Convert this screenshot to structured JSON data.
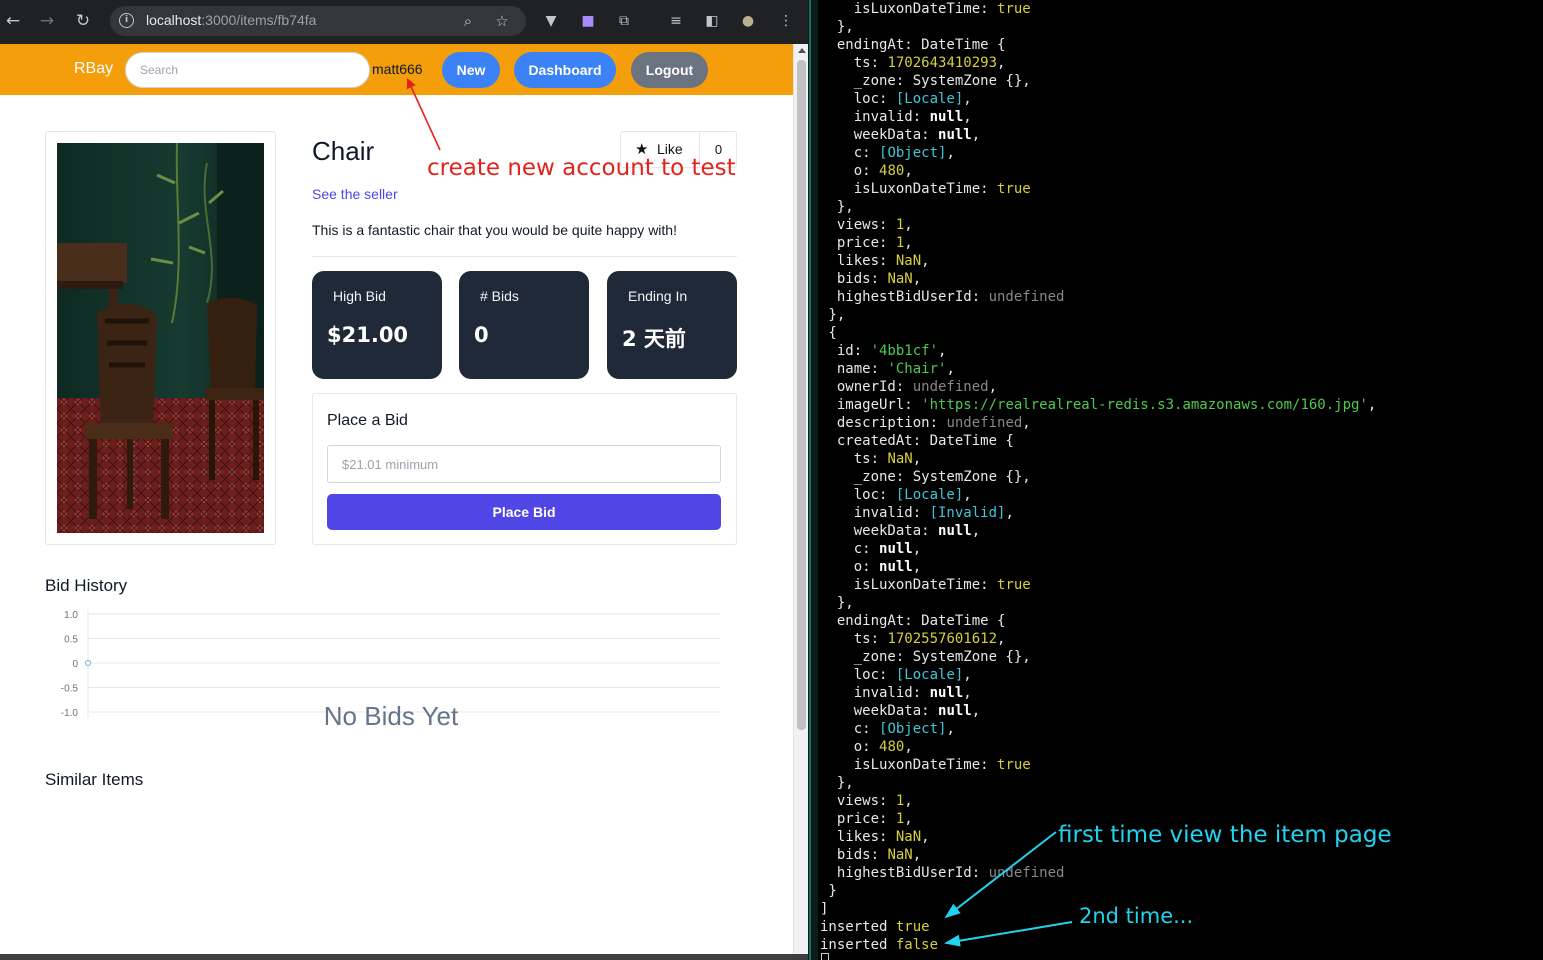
{
  "browser": {
    "url_host": "localhost",
    "url_path": ":3000/items/fb74fa"
  },
  "navbar": {
    "brand": "RBay",
    "search_placeholder": "Search",
    "username": "matt666",
    "new_label": "New",
    "dashboard_label": "Dashboard",
    "logout_label": "Logout"
  },
  "item": {
    "title": "Chair",
    "like_label": "Like",
    "like_count": "0",
    "seller_link": "See the seller",
    "description": "This is a fantastic chair that you would be quite happy with!"
  },
  "stats": [
    {
      "label": "High Bid",
      "value": "$21.00"
    },
    {
      "label": "# Bids",
      "value": "0"
    },
    {
      "label": "Ending In",
      "value": "2 天前"
    }
  ],
  "bid": {
    "title": "Place a Bid",
    "placeholder": "$21.01 minimum",
    "button": "Place Bid"
  },
  "history": {
    "title": "Bid History",
    "empty_text": "No Bids Yet"
  },
  "similar_title": "Similar Items",
  "chart_data": {
    "type": "line",
    "title": "",
    "xlabel": "",
    "ylabel": "",
    "yticks": [
      "1.0",
      "0.5",
      "0",
      "-0.5",
      "-1.0"
    ],
    "ylim": [
      -1.0,
      1.0
    ],
    "series": [
      {
        "values": [
          0
        ]
      }
    ],
    "empty_text": "No Bids Yet"
  },
  "terminal": {
    "lines": [
      [
        [
          "    isLuxonDateTime: ",
          ""
        ],
        [
          "true",
          "y"
        ]
      ],
      [
        [
          "  },",
          ""
        ]
      ],
      [
        [
          "  endingAt: DateTime {",
          ""
        ]
      ],
      [
        [
          "    ts: ",
          ""
        ],
        [
          "1702643410293",
          "y"
        ],
        [
          ",",
          ""
        ]
      ],
      [
        [
          "    _zone: SystemZone {},",
          ""
        ]
      ],
      [
        [
          "    loc: ",
          ""
        ],
        [
          "[Locale]",
          "c"
        ],
        [
          ",",
          ""
        ]
      ],
      [
        [
          "    invalid: ",
          ""
        ],
        [
          "null",
          "b"
        ],
        [
          ",",
          ""
        ]
      ],
      [
        [
          "    weekData: ",
          ""
        ],
        [
          "null",
          "b"
        ],
        [
          ",",
          ""
        ]
      ],
      [
        [
          "    c: ",
          ""
        ],
        [
          "[Object]",
          "c"
        ],
        [
          ",",
          ""
        ]
      ],
      [
        [
          "    o: ",
          ""
        ],
        [
          "480",
          "y"
        ],
        [
          ",",
          ""
        ]
      ],
      [
        [
          "    isLuxonDateTime: ",
          ""
        ],
        [
          "true",
          "y"
        ]
      ],
      [
        [
          "  },",
          ""
        ]
      ],
      [
        [
          "  views: ",
          ""
        ],
        [
          "1",
          "y"
        ],
        [
          ",",
          ""
        ]
      ],
      [
        [
          "  price: ",
          ""
        ],
        [
          "1",
          "y"
        ],
        [
          ",",
          ""
        ]
      ],
      [
        [
          "  likes: ",
          ""
        ],
        [
          "NaN",
          "y"
        ],
        [
          ",",
          ""
        ]
      ],
      [
        [
          "  bids: ",
          ""
        ],
        [
          "NaN",
          "y"
        ],
        [
          ",",
          ""
        ]
      ],
      [
        [
          "  highestBidUserId: ",
          ""
        ],
        [
          "undefined",
          "k"
        ]
      ],
      [
        [
          " },",
          ""
        ]
      ],
      [
        [
          " {",
          ""
        ]
      ],
      [
        [
          "  id: ",
          ""
        ],
        [
          "'4bb1cf'",
          "g"
        ],
        [
          ",",
          ""
        ]
      ],
      [
        [
          "  name: ",
          ""
        ],
        [
          "'Chair'",
          "g"
        ],
        [
          ",",
          ""
        ]
      ],
      [
        [
          "  ownerId: ",
          ""
        ],
        [
          "undefined",
          "k"
        ],
        [
          ",",
          ""
        ]
      ],
      [
        [
          "  imageUrl: ",
          ""
        ],
        [
          "'https://realrealreal-redis.s3.amazonaws.com/160.jpg'",
          "g"
        ],
        [
          ",",
          ""
        ]
      ],
      [
        [
          "  description: ",
          ""
        ],
        [
          "undefined",
          "k"
        ],
        [
          ",",
          ""
        ]
      ],
      [
        [
          "  createdAt: DateTime {",
          ""
        ]
      ],
      [
        [
          "    ts: ",
          ""
        ],
        [
          "NaN",
          "y"
        ],
        [
          ",",
          ""
        ]
      ],
      [
        [
          "    _zone: SystemZone {},",
          ""
        ]
      ],
      [
        [
          "    loc: ",
          ""
        ],
        [
          "[Locale]",
          "c"
        ],
        [
          ",",
          ""
        ]
      ],
      [
        [
          "    invalid: ",
          ""
        ],
        [
          "[Invalid]",
          "c"
        ],
        [
          ",",
          ""
        ]
      ],
      [
        [
          "    weekData: ",
          ""
        ],
        [
          "null",
          "b"
        ],
        [
          ",",
          ""
        ]
      ],
      [
        [
          "    c: ",
          ""
        ],
        [
          "null",
          "b"
        ],
        [
          ",",
          ""
        ]
      ],
      [
        [
          "    o: ",
          ""
        ],
        [
          "null",
          "b"
        ],
        [
          ",",
          ""
        ]
      ],
      [
        [
          "    isLuxonDateTime: ",
          ""
        ],
        [
          "true",
          "y"
        ]
      ],
      [
        [
          "  },",
          ""
        ]
      ],
      [
        [
          "  endingAt: DateTime {",
          ""
        ]
      ],
      [
        [
          "    ts: ",
          ""
        ],
        [
          "1702557601612",
          "y"
        ],
        [
          ",",
          ""
        ]
      ],
      [
        [
          "    _zone: SystemZone {},",
          ""
        ]
      ],
      [
        [
          "    loc: ",
          ""
        ],
        [
          "[Locale]",
          "c"
        ],
        [
          ",",
          ""
        ]
      ],
      [
        [
          "    invalid: ",
          ""
        ],
        [
          "null",
          "b"
        ],
        [
          ",",
          ""
        ]
      ],
      [
        [
          "    weekData: ",
          ""
        ],
        [
          "null",
          "b"
        ],
        [
          ",",
          ""
        ]
      ],
      [
        [
          "    c: ",
          ""
        ],
        [
          "[Object]",
          "c"
        ],
        [
          ",",
          ""
        ]
      ],
      [
        [
          "    o: ",
          ""
        ],
        [
          "480",
          "y"
        ],
        [
          ",",
          ""
        ]
      ],
      [
        [
          "    isLuxonDateTime: ",
          ""
        ],
        [
          "true",
          "y"
        ]
      ],
      [
        [
          "  },",
          ""
        ]
      ],
      [
        [
          "  views: ",
          ""
        ],
        [
          "1",
          "y"
        ],
        [
          ",",
          ""
        ]
      ],
      [
        [
          "  price: ",
          ""
        ],
        [
          "1",
          "y"
        ],
        [
          ",",
          ""
        ]
      ],
      [
        [
          "  likes: ",
          ""
        ],
        [
          "NaN",
          "y"
        ],
        [
          ",",
          ""
        ]
      ],
      [
        [
          "  bids: ",
          ""
        ],
        [
          "NaN",
          "y"
        ],
        [
          ",",
          ""
        ]
      ],
      [
        [
          "  highestBidUserId: ",
          ""
        ],
        [
          "undefined",
          "k"
        ]
      ],
      [
        [
          " }",
          ""
        ]
      ],
      [
        [
          "]",
          ""
        ]
      ],
      [
        [
          "inserted ",
          ""
        ],
        [
          "true",
          "y"
        ]
      ],
      [
        [
          "inserted ",
          ""
        ],
        [
          "false",
          "y"
        ]
      ]
    ]
  },
  "annotations": {
    "red_note": "create new account to test",
    "cyan_note_1": "first time view the item page",
    "cyan_note_2": "2nd time..."
  },
  "colors": {
    "navbar": "#f59e0b",
    "primary_button": "#3b82f6",
    "bid_button": "#4f46e5",
    "stat_card": "#1f2937",
    "annotation_red": "#e3231b",
    "annotation_cyan": "#22d3ee"
  }
}
